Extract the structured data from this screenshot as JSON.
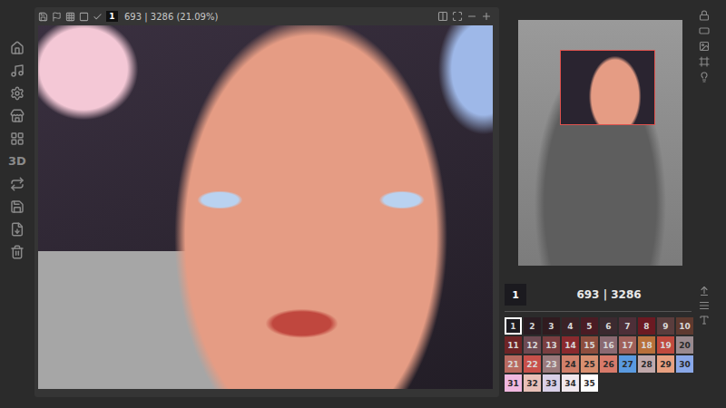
{
  "toolbar": {
    "current_color": "1",
    "progress": "693 | 3286 (21.09%)"
  },
  "sidebar": {
    "items": [
      {
        "kind": "icon"
      },
      {
        "kind": "icon"
      },
      {
        "kind": "icon"
      },
      {
        "kind": "icon"
      },
      {
        "kind": "icon"
      },
      {
        "kind": "text",
        "label": "3D"
      },
      {
        "kind": "icon"
      },
      {
        "kind": "icon"
      },
      {
        "kind": "icon"
      },
      {
        "kind": "icon"
      }
    ]
  },
  "selection": {
    "number": "1",
    "count": "693 | 3286"
  },
  "palette": [
    {
      "number": "1",
      "color": "#1b1a1f",
      "selected": true
    },
    {
      "number": "2",
      "color": "#2a1c22",
      "selected": false
    },
    {
      "number": "3",
      "color": "#301b1f",
      "selected": false
    },
    {
      "number": "4",
      "color": "#3a2226",
      "selected": false
    },
    {
      "number": "5",
      "color": "#4a1c24",
      "selected": false
    },
    {
      "number": "6",
      "color": "#3b2a30",
      "selected": false
    },
    {
      "number": "7",
      "color": "#4d2f38",
      "selected": false
    },
    {
      "number": "8",
      "color": "#6b1a22",
      "selected": false
    },
    {
      "number": "9",
      "color": "#5a3d3d",
      "selected": false
    },
    {
      "number": "10",
      "color": "#5e3a30",
      "selected": false
    },
    {
      "number": "11",
      "color": "#6e2426",
      "selected": false
    },
    {
      "number": "12",
      "color": "#6e4a52",
      "selected": false
    },
    {
      "number": "13",
      "color": "#7a3e40",
      "selected": false
    },
    {
      "number": "14",
      "color": "#8a2a2e",
      "selected": false
    },
    {
      "number": "15",
      "color": "#8e4e3e",
      "selected": false
    },
    {
      "number": "16",
      "color": "#8a6a72",
      "selected": false
    },
    {
      "number": "17",
      "color": "#a0605a",
      "selected": false
    },
    {
      "number": "18",
      "color": "#b8703a",
      "selected": false
    },
    {
      "number": "19",
      "color": "#c04a3e",
      "selected": false
    },
    {
      "number": "20",
      "color": "#9a8a8e",
      "selected": false
    },
    {
      "number": "21",
      "color": "#b86a60",
      "selected": false
    },
    {
      "number": "22",
      "color": "#c8504a",
      "selected": false
    },
    {
      "number": "23",
      "color": "#9a7a7c",
      "selected": false
    },
    {
      "number": "24",
      "color": "#d0806a",
      "selected": false
    },
    {
      "number": "25",
      "color": "#d89070",
      "selected": false
    },
    {
      "number": "26",
      "color": "#d87a6a",
      "selected": false
    },
    {
      "number": "27",
      "color": "#5a9ae0",
      "selected": false
    },
    {
      "number": "28",
      "color": "#c0a8aa",
      "selected": false
    },
    {
      "number": "29",
      "color": "#e8a080",
      "selected": false
    },
    {
      "number": "30",
      "color": "#8aa8e8",
      "selected": false
    },
    {
      "number": "31",
      "color": "#f0b8e0",
      "selected": false
    },
    {
      "number": "32",
      "color": "#e8c0b8",
      "selected": false
    },
    {
      "number": "33",
      "color": "#d8d0e8",
      "selected": false
    },
    {
      "number": "34",
      "color": "#f0e8ee",
      "selected": false
    },
    {
      "number": "35",
      "color": "#ffffff",
      "selected": false
    }
  ]
}
